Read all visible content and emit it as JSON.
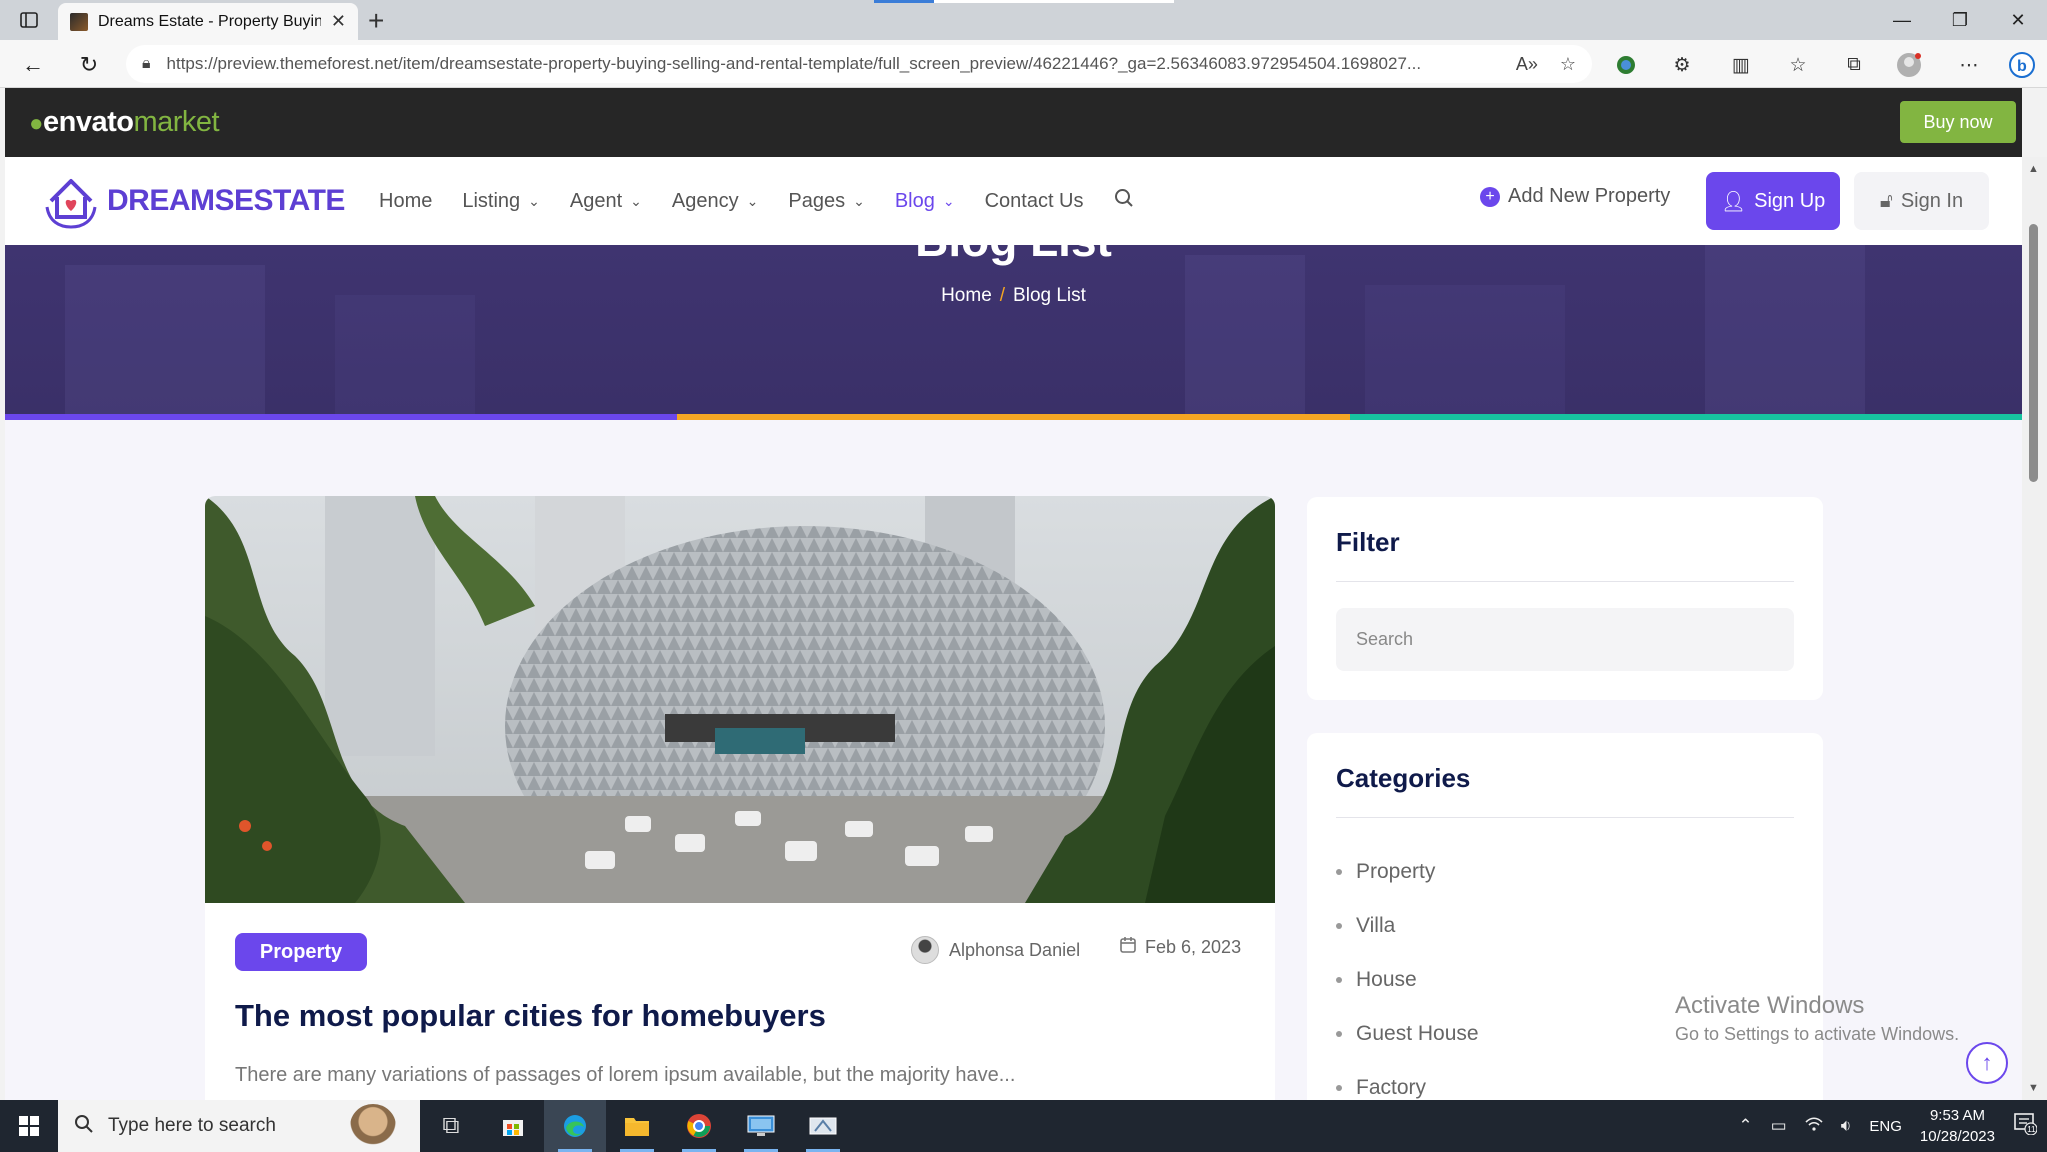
{
  "browser": {
    "tab_title": "Dreams Estate - Property Buying",
    "url": "https://preview.themeforest.net/item/dreamsestate-property-buying-selling-and-rental-template/full_screen_preview/46221446?_ga=2.56346083.972954504.1698027..."
  },
  "envato": {
    "logo_main": "envato",
    "logo_market": "market",
    "buy_now": "Buy now"
  },
  "header": {
    "logo_dreams": "DREAMS",
    "logo_estate": "ESTATE",
    "nav": {
      "home": "Home",
      "listing": "Listing",
      "agent": "Agent",
      "agency": "Agency",
      "pages": "Pages",
      "blog": "Blog",
      "contact": "Contact Us"
    },
    "add_property": "Add New Property",
    "sign_up": "Sign Up",
    "sign_in": "Sign In"
  },
  "banner": {
    "title": "Blog List",
    "crumb_home": "Home",
    "crumb_sep": "/",
    "crumb_current": "Blog List",
    "stripe_colors": [
      "#6b47ec",
      "#f5a623",
      "#17c3a0"
    ]
  },
  "post": {
    "tag": "Property",
    "author": "Alphonsa Daniel",
    "date": "Feb 6, 2023",
    "title": "The most popular cities for homebuyers",
    "excerpt": "There are many variations of passages of lorem ipsum available, but the majority have..."
  },
  "sidebar": {
    "filter_heading": "Filter",
    "search_placeholder": "Search",
    "categories_heading": "Categories",
    "categories": [
      "Property",
      "Villa",
      "House",
      "Guest House",
      "Factory"
    ]
  },
  "watermark": {
    "title": "Activate Windows",
    "subtitle": "Go to Settings to activate Windows."
  },
  "taskbar": {
    "search_placeholder": "Type here to search",
    "lang": "ENG",
    "time": "9:53 AM",
    "date": "10/28/2023",
    "notifications": "11"
  },
  "colors": {
    "brand_purple": "#6b47ec",
    "envato_green": "#82b541",
    "banner_bg": "#3f3470"
  }
}
